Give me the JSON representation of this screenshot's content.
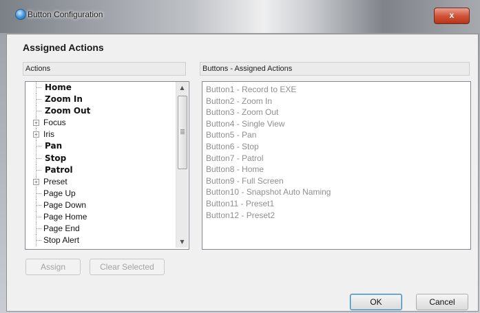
{
  "window": {
    "title": "Button Configuration",
    "close_glyph": "x"
  },
  "section_title": "Assigned Actions",
  "actions_panel": {
    "header": "Actions",
    "items": [
      {
        "label": "Home",
        "bold": true,
        "expandable": false
      },
      {
        "label": "Zoom In",
        "bold": true,
        "expandable": false
      },
      {
        "label": "Zoom Out",
        "bold": true,
        "expandable": false
      },
      {
        "label": "Focus",
        "bold": false,
        "expandable": true
      },
      {
        "label": "Iris",
        "bold": false,
        "expandable": true
      },
      {
        "label": "Pan",
        "bold": true,
        "expandable": false
      },
      {
        "label": "Stop",
        "bold": true,
        "expandable": false
      },
      {
        "label": "Patrol",
        "bold": true,
        "expandable": false
      },
      {
        "label": "Preset",
        "bold": false,
        "expandable": true
      },
      {
        "label": "Page Up",
        "bold": false,
        "expandable": false
      },
      {
        "label": "Page Down",
        "bold": false,
        "expandable": false
      },
      {
        "label": "Page Home",
        "bold": false,
        "expandable": false
      },
      {
        "label": "Page End",
        "bold": false,
        "expandable": false
      },
      {
        "label": "Stop Alert",
        "bold": false,
        "expandable": false
      }
    ]
  },
  "assigned_panel": {
    "header": "Buttons - Assigned Actions",
    "rows": [
      "Button1  - Record to EXE",
      "Button2  - Zoom In",
      "Button3  - Zoom Out",
      "Button4  - Single View",
      "Button5  - Pan",
      "Button6  - Stop",
      "Button7  - Patrol",
      "Button8  - Home",
      "Button9  - Full Screen",
      "Button10 - Snapshot Auto Naming",
      "Button11 - Preset1",
      "Button12 - Preset2"
    ]
  },
  "buttons": {
    "assign": "Assign",
    "clear_selected": "Clear Selected",
    "ok": "OK",
    "cancel": "Cancel"
  },
  "icons": {
    "app": "app-icon",
    "close": "close-icon",
    "expand": "plus-expander-icon",
    "scroll_up": "scroll-up-arrow-icon",
    "scroll_down": "scroll-down-arrow-icon"
  }
}
